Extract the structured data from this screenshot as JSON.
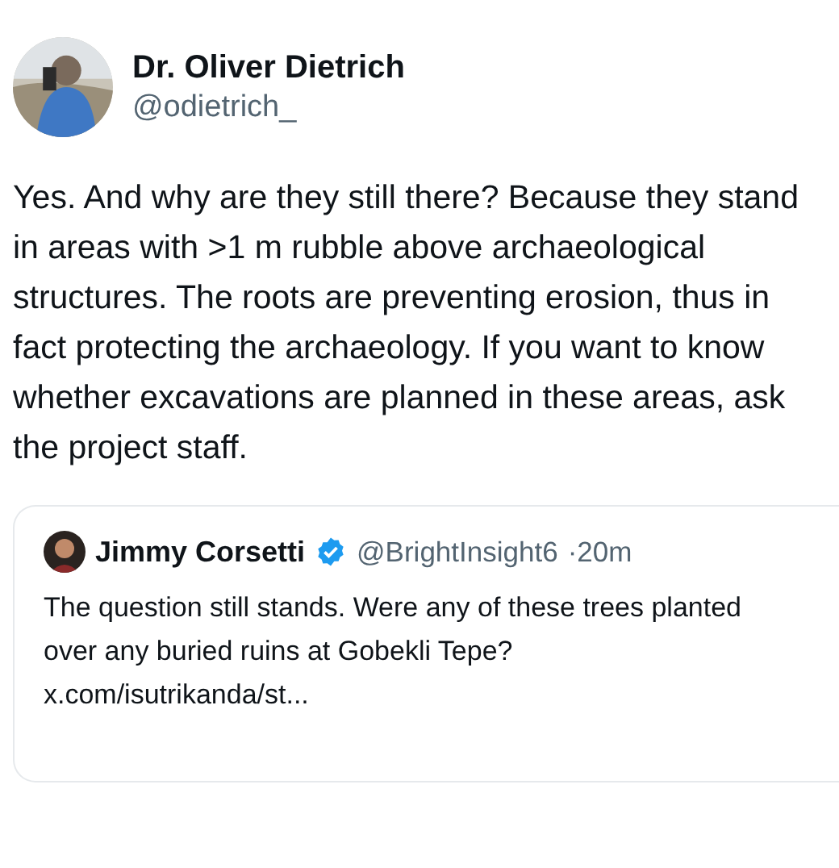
{
  "author": {
    "name": "Dr. Oliver Dietrich",
    "handle": "@odietrich_"
  },
  "text": "Yes. And why are they still there? Because they stand in areas with >1 m rubble above archaeological structures. The roots are preventing erosion, thus in fact protecting the archaeology. If you want to know whether excavations are planned in these areas, ask the project staff.",
  "quoted_post": {
    "author": {
      "name": "Jimmy Corsetti",
      "verified": true,
      "handle": "@BrightInsight6",
      "time": "·20m"
    },
    "text": "The question still stands. Were any of these trees planted over any buried ruins at Gobekli Tepe?",
    "link": "x.com/isutrikanda/st..."
  }
}
